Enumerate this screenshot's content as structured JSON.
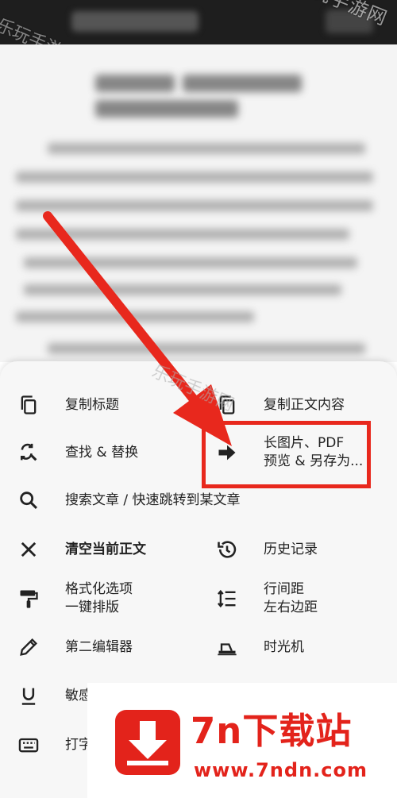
{
  "watermark": {
    "text": "乐玩手游网"
  },
  "menu": {
    "left": [
      {
        "label": "复制标题",
        "icon": "copy-icon"
      },
      {
        "label": "查找 & 替换",
        "icon": "find-replace-icon"
      },
      {
        "label": "搜索文章 / 快速跳转到某文章",
        "icon": "search-icon"
      },
      {
        "label": "清空当前正文",
        "icon": "close-icon"
      },
      {
        "label_line1": "格式化选项",
        "label_line2": "一键排版",
        "icon": "paint-roller-icon"
      },
      {
        "label": "第二编辑器",
        "icon": "pencil-icon"
      },
      {
        "label": "敏感",
        "icon": "underline-icon"
      },
      {
        "label": "打字",
        "icon": "keyboard-icon"
      }
    ],
    "right": [
      {
        "label": "复制正文内容",
        "icon": "copy-icon"
      },
      {
        "label_line1": "长图片、PDF",
        "label_line2": "预览 & 另存为...",
        "icon": "arrow-right-icon"
      },
      {
        "label": "历史记录",
        "icon": "history-icon"
      },
      {
        "label_line1": "行间距",
        "label_line2": "左右边距",
        "icon": "line-spacing-icon"
      },
      {
        "label": "时光机",
        "icon": "time-machine-icon"
      }
    ]
  },
  "annotation": {
    "color": "#e8281d"
  },
  "banner": {
    "brand": "7n下载站",
    "url": "www.7ndn.com",
    "color": "#e3231b"
  }
}
